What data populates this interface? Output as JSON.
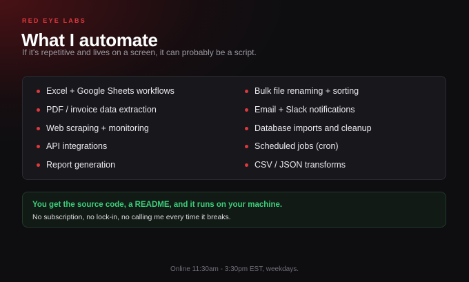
{
  "header": {
    "brand": "RED EYE LABS",
    "title": "What I automate",
    "subtitle": "If it's repetitive and lives on a screen, it can probably be a script."
  },
  "services": {
    "left": [
      "Excel + Google Sheets workflows",
      "PDF / invoice data extraction",
      "Web scraping + monitoring",
      "API integrations",
      "Report generation"
    ],
    "right": [
      "Bulk file renaming + sorting",
      "Email + Slack notifications",
      "Database imports and cleanup",
      "Scheduled jobs (cron)",
      "CSV / JSON transforms"
    ]
  },
  "note": {
    "headline": "You get the source code, a README, and it runs on your machine.",
    "body": "No subscription, no lock-in, no calling me every time it breaks."
  },
  "footer": {
    "hours": "Online 11:30am - 3:30pm EST, weekdays."
  },
  "colors": {
    "accent": "#e0383c",
    "success": "#3ccf7a",
    "background": "#0e0e11"
  }
}
